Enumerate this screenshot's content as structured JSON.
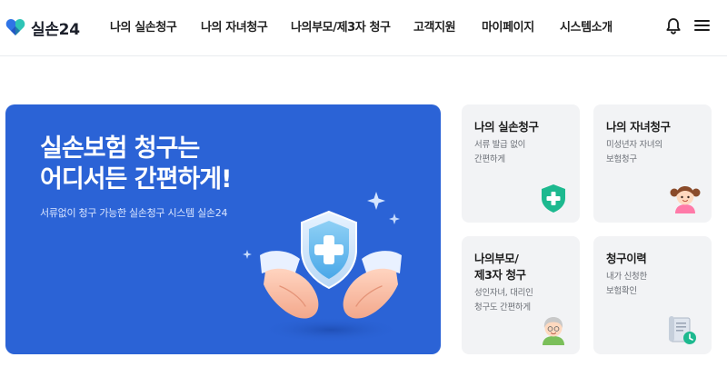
{
  "header": {
    "logo_text": "실손24",
    "nav": [
      "나의 실손청구",
      "나의 자녀청구",
      "나의부모/제3자 청구",
      "고객지원",
      "마이페이지",
      "시스템소개"
    ],
    "icons": [
      "bell-icon",
      "menu-icon"
    ]
  },
  "banner": {
    "title_line1": "실손보험 청구는",
    "title_line2": "어디서든 간편하게!",
    "subtitle": "서류없이 청구 가능한 실손청구 시스템 실손24"
  },
  "cards": [
    {
      "title": [
        "나의 실손청구"
      ],
      "desc": [
        "서류 발급 없이",
        "간편하게"
      ],
      "icon": "shield-cross-icon"
    },
    {
      "title": [
        "나의 자녀청구"
      ],
      "desc": [
        "미성년자 자녀의",
        "보험청구"
      ],
      "icon": "child-icon"
    },
    {
      "title": [
        "나의부모/",
        "제3자 청구"
      ],
      "desc": [
        "성인자녀, 대리인",
        "청구도 간편하게"
      ],
      "icon": "grandparent-icon"
    },
    {
      "title": [
        "청구이력"
      ],
      "desc": [
        "내가 신청한",
        "보험확인"
      ],
      "icon": "document-clock-icon"
    }
  ],
  "colors": {
    "banner_bg": "#2b63d6",
    "accent_green": "#1db98f",
    "logo_blue": "#2f74e6",
    "logo_teal": "#2ec4b6"
  }
}
